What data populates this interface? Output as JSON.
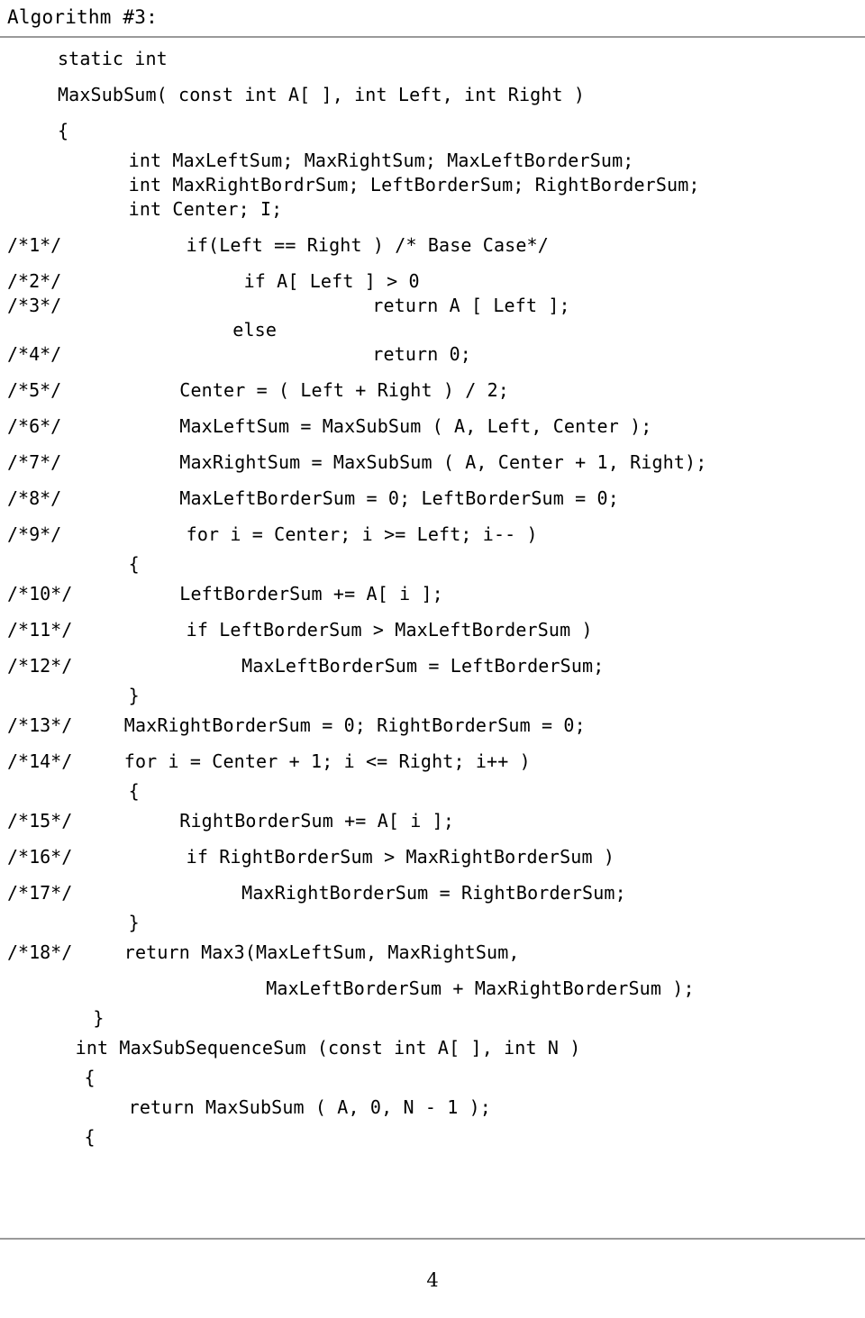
{
  "header": {
    "title": "Algorithm #3:"
  },
  "listing": {
    "lines": [
      {
        "label": "",
        "indent": 5.2,
        "code": "static int",
        "spacing": "normal"
      },
      {
        "label": "",
        "indent": 5.2,
        "code": "MaxSubSum( const int A[ ], int Left, int Right )",
        "spacing": "normal"
      },
      {
        "label": "",
        "indent": 5.2,
        "code": "{",
        "spacing": "gap-sm"
      },
      {
        "label": "",
        "indent": 11.6,
        "code": "int MaxLeftSum; MaxRightSum; MaxLeftBorderSum;",
        "spacing": "tight"
      },
      {
        "label": "",
        "indent": 11.6,
        "code": "int MaxRightBordrSum; LeftBorderSum; RightBorderSum;",
        "spacing": "tight"
      },
      {
        "label": "",
        "indent": 11.6,
        "code": "int Center; I;",
        "spacing": "normal"
      },
      {
        "label": "/*1*/",
        "indent": 16.8,
        "code": "if(Left == Right ) /* Base Case*/",
        "spacing": "normal"
      },
      {
        "label": "/*2*/",
        "indent": 22.0,
        "code": "if A[ Left ] > 0",
        "spacing": "tight"
      },
      {
        "label": "/*3*/",
        "indent": 33.6,
        "code": "return A [ Left ];",
        "spacing": "tight"
      },
      {
        "label": "",
        "indent": 21.0,
        "code": "else",
        "spacing": "tight"
      },
      {
        "label": "/*4*/",
        "indent": 33.6,
        "code": "return 0;",
        "spacing": "normal"
      },
      {
        "label": "/*5*/",
        "indent": 16.2,
        "code": "Center = ( Left + Right ) / 2;",
        "spacing": "normal"
      },
      {
        "label": "/*6*/",
        "indent": 16.2,
        "code": "MaxLeftSum = MaxSubSum ( A, Left, Center );",
        "spacing": "normal"
      },
      {
        "label": "/*7*/",
        "indent": 16.2,
        "code": "MaxRightSum = MaxSubSum ( A, Center + 1, Right);",
        "spacing": "normal"
      },
      {
        "label": "/*8*/",
        "indent": 16.2,
        "code": "MaxLeftBorderSum = 0; LeftBorderSum = 0;",
        "spacing": "normal"
      },
      {
        "label": "/*9*/",
        "indent": 16.8,
        "code": "for i = Center; i >= Left; i-- )",
        "spacing": "gap-sm"
      },
      {
        "label": "",
        "indent": 11.6,
        "code": "{",
        "spacing": "gap-sm"
      },
      {
        "label": "/*10*/",
        "indent": 16.2,
        "code": "LeftBorderSum += A[ i ];",
        "spacing": "normal"
      },
      {
        "label": "/*11*/",
        "indent": 16.8,
        "code": "if LeftBorderSum > MaxLeftBorderSum )",
        "spacing": "normal"
      },
      {
        "label": "/*12*/",
        "indent": 21.8,
        "code": "MaxLeftBorderSum = LeftBorderSum;",
        "spacing": "gap-sm"
      },
      {
        "label": "",
        "indent": 11.6,
        "code": "}",
        "spacing": "gap-sm"
      },
      {
        "label": "/*13*/",
        "indent": 11.2,
        "code": "MaxRightBorderSum = 0; RightBorderSum = 0;",
        "spacing": "normal"
      },
      {
        "label": "/*14*/",
        "indent": 11.2,
        "code": "for i = Center + 1; i <= Right; i++ )",
        "spacing": "gap-sm"
      },
      {
        "label": "",
        "indent": 11.6,
        "code": "{",
        "spacing": "gap-sm"
      },
      {
        "label": "/*15*/",
        "indent": 16.2,
        "code": "RightBorderSum += A[ i ];",
        "spacing": "normal"
      },
      {
        "label": "/*16*/",
        "indent": 16.8,
        "code": "if RightBorderSum > MaxRightBorderSum )",
        "spacing": "normal"
      },
      {
        "label": "/*17*/",
        "indent": 21.8,
        "code": "MaxRightBorderSum = RightBorderSum;",
        "spacing": "gap-sm"
      },
      {
        "label": "",
        "indent": 11.6,
        "code": "}",
        "spacing": "gap-sm"
      },
      {
        "label": "/*18*/",
        "indent": 11.2,
        "code": "return Max3(MaxLeftSum, MaxRightSum,",
        "spacing": "normal"
      },
      {
        "label": "",
        "indent": 24.0,
        "code": "MaxLeftBorderSum + MaxRightBorderSum );",
        "spacing": "gap-sm"
      },
      {
        "label": "",
        "indent": 8.4,
        "code": "}",
        "spacing": "gap-sm"
      },
      {
        "label": "",
        "indent": 6.8,
        "code": "int MaxSubSequenceSum (const int A[ ], int N )",
        "spacing": "gap-sm"
      },
      {
        "label": "",
        "indent": 7.6,
        "code": "{",
        "spacing": "gap-sm"
      },
      {
        "label": "",
        "indent": 11.6,
        "code": "return MaxSubSum ( A, 0, N - 1 );",
        "spacing": "gap-sm"
      },
      {
        "label": "",
        "indent": 7.6,
        "code": "{",
        "spacing": "normal"
      }
    ]
  },
  "footer": {
    "page_number": "4"
  }
}
